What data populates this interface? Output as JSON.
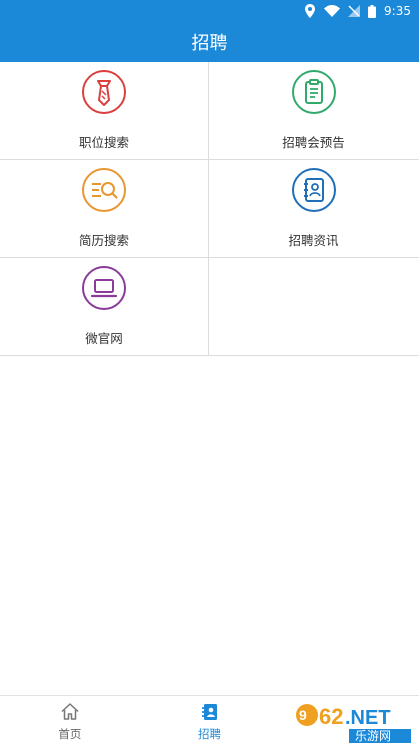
{
  "status": {
    "time": "9:35"
  },
  "title": "招聘",
  "grid": [
    {
      "label": "职位搜索",
      "icon": "tie-icon",
      "color": "#d9403f"
    },
    {
      "label": "招聘会预告",
      "icon": "clipboard-icon",
      "color": "#2faa6b"
    },
    {
      "label": "简历搜索",
      "icon": "resume-search-icon",
      "color": "#e8962f"
    },
    {
      "label": "招聘资讯",
      "icon": "contact-book-icon",
      "color": "#1f6fb8"
    },
    {
      "label": "微官网",
      "icon": "laptop-icon",
      "color": "#8a3b99"
    }
  ],
  "tabs": [
    {
      "label": "首页",
      "icon": "home-icon"
    },
    {
      "label": "招聘",
      "icon": "recruit-icon",
      "active": true
    }
  ],
  "watermark": {
    "brand": "962.NET",
    "sub": "乐游网"
  },
  "colors": {
    "primary": "#1c88d8"
  }
}
